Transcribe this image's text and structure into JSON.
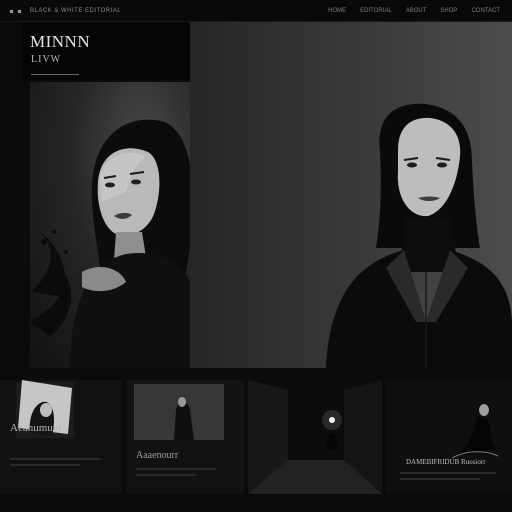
{
  "topbar": {
    "site_name": "BLACK & WHITE EDITORIAL",
    "nav": [
      "HOME",
      "EDITORIAL",
      "ABOUT",
      "SHOP",
      "CONTACT"
    ]
  },
  "brand": {
    "title": "MINNN",
    "subtitle": "LIVW"
  },
  "cards": [
    {
      "caption": "Aeanumunf"
    },
    {
      "caption": "Aaaenourr"
    },
    {
      "caption": ""
    },
    {
      "caption": "DAMEBIFRIDUB  Ruosiorr"
    }
  ],
  "colors": {
    "background": "#0b0b0b",
    "panel": "#121212",
    "accent": "#e6e6e6"
  },
  "icons": [
    "menu-dots-icon"
  ]
}
